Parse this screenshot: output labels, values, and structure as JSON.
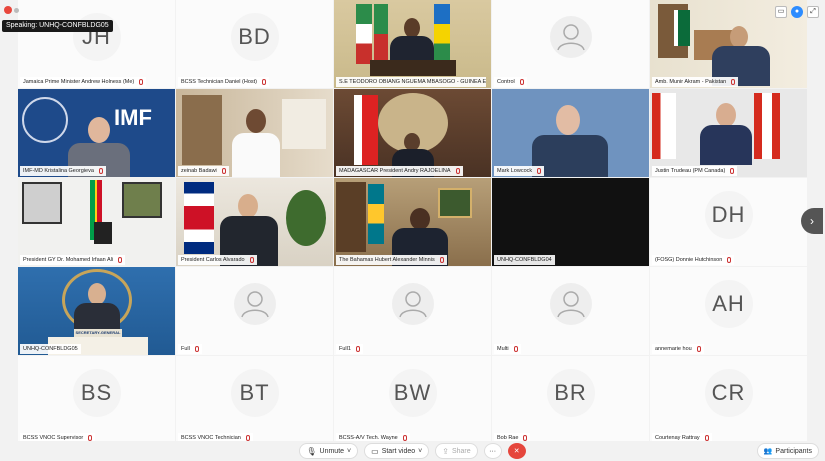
{
  "speaking_banner": "Speaking: UNHQ-CONFBLDG05",
  "tiles": [
    {
      "label": "Jamaica Prime Minister Andrew Holness (Me)",
      "initials": "JH"
    },
    {
      "label": "BCSS Technician Daniel (Host)",
      "initials": "BD"
    },
    {
      "label": "S.E TEODORO OBIANG NGUEMA MBASOGO - GUINEA E..."
    },
    {
      "label": "Control"
    },
    {
      "label": "Amb. Munir Akram - Pakistan"
    },
    {
      "label": "IMF-MD Kristalina Georgieva",
      "logo": "IMF"
    },
    {
      "label": "zeinab Badawi"
    },
    {
      "label": "MADAGASCAR President Andry RAJOELINA"
    },
    {
      "label": "Mark Lowcock"
    },
    {
      "label": "Justin Trudeau (PM Canada)"
    },
    {
      "label": "President GY Dr. Mohamed Irfaan Ali"
    },
    {
      "label": "President Carlos Alvarado"
    },
    {
      "label": "The Bahamas Hubert Alexander Minnis"
    },
    {
      "label": "UNHQ-CONFBLDG04"
    },
    {
      "label": "(FOSG) Donnie Hutchinson",
      "initials": "DH"
    },
    {
      "label": "UNHQ-CONFBLDG05",
      "podium": "SECRETARY-GENERAL"
    },
    {
      "label": "Full"
    },
    {
      "label": "Full1"
    },
    {
      "label": "Multi"
    },
    {
      "label": "annemarie hou",
      "initials": "AH"
    },
    {
      "label": "BCSS VNOC Supervisor",
      "initials": "BS"
    },
    {
      "label": "BCSS VNOC Technician",
      "initials": "BT"
    },
    {
      "label": "BCSS-A/V Tech. Wayne",
      "initials": "BW"
    },
    {
      "label": "Bob Rae",
      "initials": "BR"
    },
    {
      "label": "Courtenay Rattray",
      "initials": "CR"
    }
  ],
  "toolbar": {
    "unmute": "Unmute",
    "start_video": "Start video",
    "share": "Share",
    "more": "···",
    "participants": "Participants"
  },
  "colors": {
    "accent_active": "#2dd0e6",
    "end_red": "#e5463c",
    "brand_blue": "#2d8cff"
  }
}
